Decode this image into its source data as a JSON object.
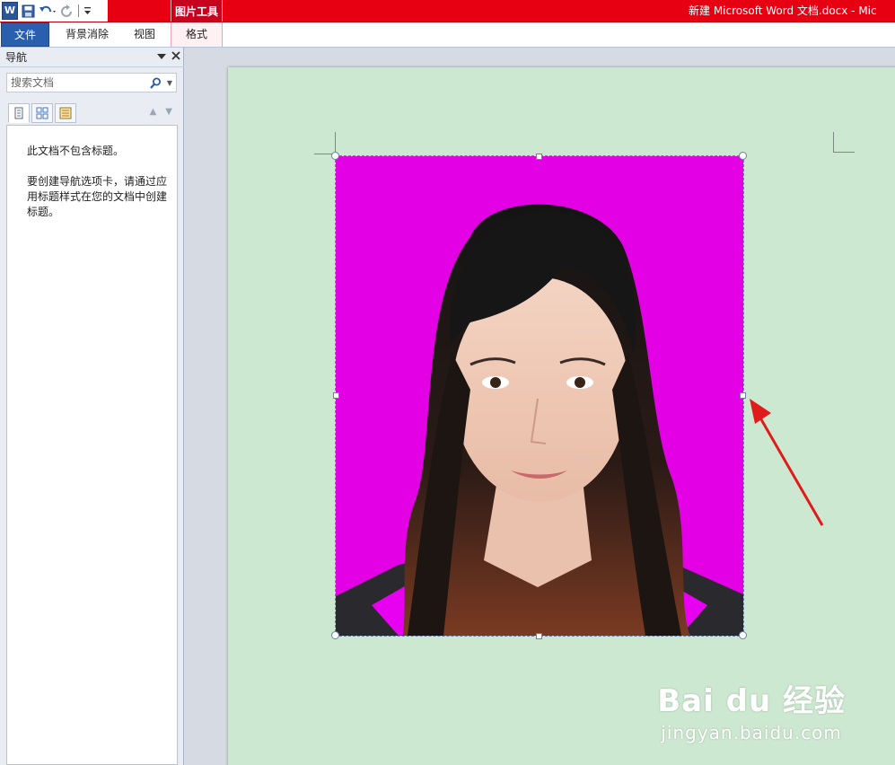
{
  "titlebar": {
    "window_title": "新建 Microsoft Word 文档.docx - Mic",
    "context_group": "图片工具",
    "qat_icons": [
      "word-logo",
      "save-icon",
      "undo-icon",
      "redo-icon",
      "customize-icon"
    ],
    "word_logo_letter": "W"
  },
  "ribbon": {
    "tabs": [
      "文件",
      "背景消除",
      "视图",
      "格式"
    ]
  },
  "nav": {
    "title": "导航",
    "search_placeholder": "搜索文档",
    "message1": "此文档不包含标题。",
    "message2": "要创建导航选项卡，请通过应用标题样式在您的文档中创建标题。"
  },
  "watermark": {
    "main": "Bai du 经验",
    "sub": "jingyan.baidu.com"
  },
  "colors": {
    "titlebar": "#e60012",
    "page": "#cde8d0",
    "photo_background": "#e400e4",
    "arrow": "#e01b1b"
  }
}
